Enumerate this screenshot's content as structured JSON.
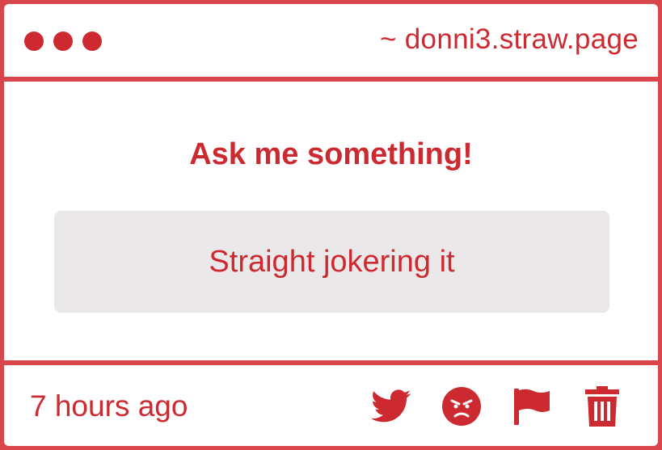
{
  "window": {
    "domain": "~ donni3.straw.page"
  },
  "main": {
    "question": "Ask me something!",
    "answer": "Straight jokering it"
  },
  "footer": {
    "timestamp": "7 hours ago",
    "actions": [
      "twitter-icon",
      "angry-face-icon",
      "flag-icon",
      "trash-icon"
    ]
  },
  "colors": {
    "accent": "#cc2a30",
    "border": "#d8464c",
    "answer_background": "#ebe8e9"
  }
}
